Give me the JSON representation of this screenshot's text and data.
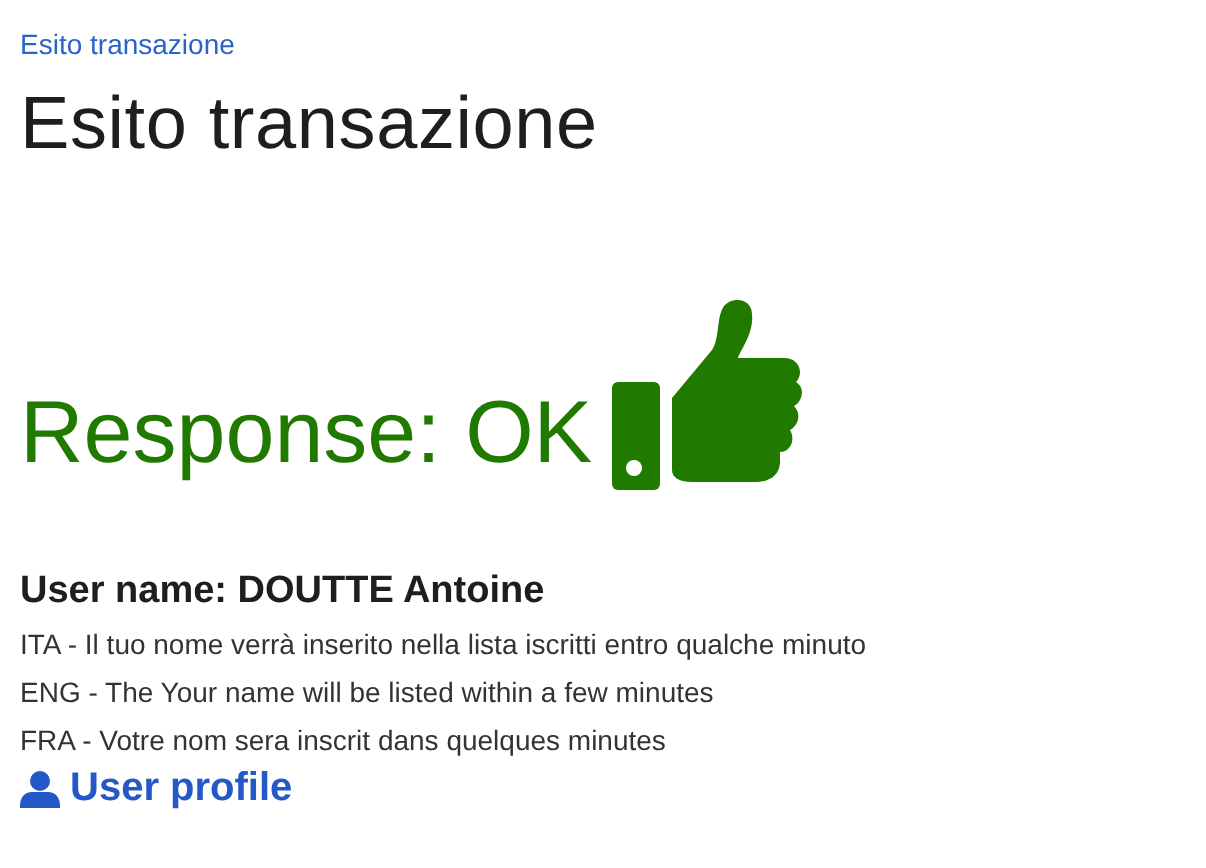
{
  "breadcrumb": {
    "label": "Esito transazione"
  },
  "title": "Esito transazione",
  "response": {
    "text": "Response: OK",
    "success": true
  },
  "user_name": "User name: DOUTTE Antoine",
  "messages": [
    "ITA - Il tuo nome verrà inserito nella lista iscritti entro qualche minuto",
    "ENG - The Your name will be listed within a few minutes",
    "FRA - Votre nom sera inscrit dans quelques minutes"
  ],
  "profile_link": {
    "label": "User profile"
  }
}
